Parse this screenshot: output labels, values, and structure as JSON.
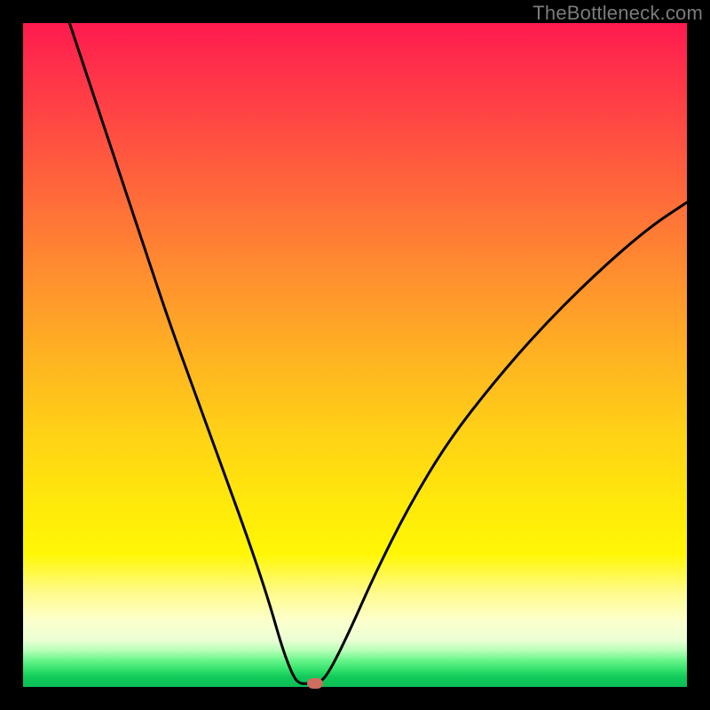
{
  "watermark": "TheBottleneck.com",
  "colors": {
    "curve_stroke": "#000000",
    "marker_fill": "#cf6d61",
    "frame": "#000000"
  },
  "chart_data": {
    "type": "line",
    "title": "",
    "xlabel": "",
    "ylabel": "",
    "xlim": [
      0,
      100
    ],
    "ylim": [
      0,
      100
    ],
    "grid": false,
    "legend": null,
    "notes": "Axes are unlabeled; values are normalized 0–100. The curve forms a V/cusp shape reaching ~0 near x≈42 then rising again. Background is a vertical heat gradient (red top → green bottom).",
    "series": [
      {
        "name": "curve",
        "points": [
          {
            "x": 7.0,
            "y": 100.0
          },
          {
            "x": 10.0,
            "y": 91.0
          },
          {
            "x": 14.0,
            "y": 79.0
          },
          {
            "x": 18.0,
            "y": 67.0
          },
          {
            "x": 22.0,
            "y": 55.0
          },
          {
            "x": 26.0,
            "y": 44.0
          },
          {
            "x": 30.0,
            "y": 33.0
          },
          {
            "x": 34.0,
            "y": 22.0
          },
          {
            "x": 37.0,
            "y": 13.0
          },
          {
            "x": 39.0,
            "y": 6.0
          },
          {
            "x": 40.5,
            "y": 2.0
          },
          {
            "x": 41.5,
            "y": 0.5
          },
          {
            "x": 43.0,
            "y": 0.5
          },
          {
            "x": 44.5,
            "y": 0.5
          },
          {
            "x": 46.0,
            "y": 2.0
          },
          {
            "x": 49.0,
            "y": 8.0
          },
          {
            "x": 53.0,
            "y": 17.0
          },
          {
            "x": 58.0,
            "y": 27.0
          },
          {
            "x": 64.0,
            "y": 37.0
          },
          {
            "x": 71.0,
            "y": 46.0
          },
          {
            "x": 78.0,
            "y": 54.0
          },
          {
            "x": 86.0,
            "y": 62.0
          },
          {
            "x": 94.0,
            "y": 69.0
          },
          {
            "x": 100.0,
            "y": 73.0
          }
        ]
      }
    ],
    "marker": {
      "x": 44.0,
      "y": 0.5
    }
  }
}
